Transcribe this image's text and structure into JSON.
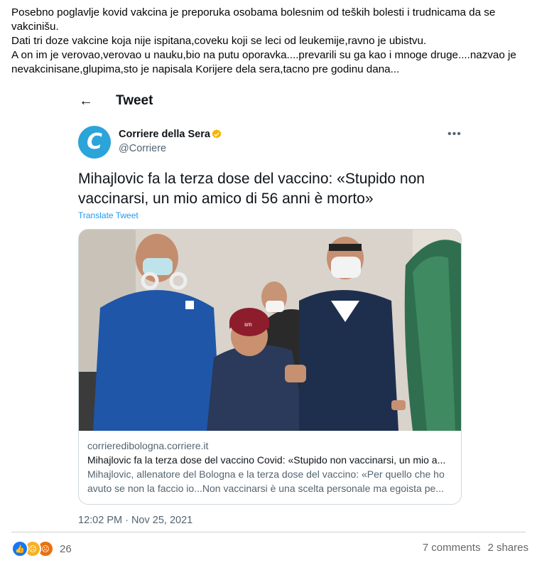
{
  "post": {
    "line1": "Posebno poglavlje kovid vakcina je preporuka osobama bolesnim od teških bolesti i trudnicama da se vakcinišu.",
    "line2": "Dati tri doze vakcine koja nije ispitana,coveku koji se leci od leukemije,ravno je ubistvu.",
    "line3": "A on im je verovao,verovao u nauku,bio na putu oporavka....prevarili su ga kao i mnoge druge....nazvao je nevakcinisane,glupima,sto je napisala Korijere dela sera,tacno pre godinu dana..."
  },
  "tweet": {
    "header_title": "Tweet",
    "back_icon": "arrow-left-icon",
    "author_name": "Corriere della Sera",
    "author_handle": "@Corriere",
    "avatar_letter": "C",
    "verified_color": "#f4b400",
    "text": "Mihajlovic fa la terza dose del vaccino: «Stupido non vaccinarsi, un mio amico di 56 anni è morto»",
    "translate_label": "Translate Tweet",
    "timestamp": "12:02 PM · Nov 25, 2021",
    "card": {
      "domain": "corrieredibologna.corriere.it",
      "title": "Mihajlovic fa la terza dose del vaccino Covid: «Stupido non vaccinarsi, un mio a...",
      "description": "Mihajlovic, allenatore del Bologna e la terza dose del vaccino: «Per quello che ho avuto se non la faccio io...Non vaccinarsi è una scelta personale ma egoista pe...",
      "image_label": "sm"
    }
  },
  "footer": {
    "reaction_count": "26",
    "comments": "7 comments",
    "shares": "2 shares"
  },
  "colors": {
    "accent": "#1d9bf0",
    "avatar_bg": "#2ba4d9",
    "like": "#1877f2"
  }
}
